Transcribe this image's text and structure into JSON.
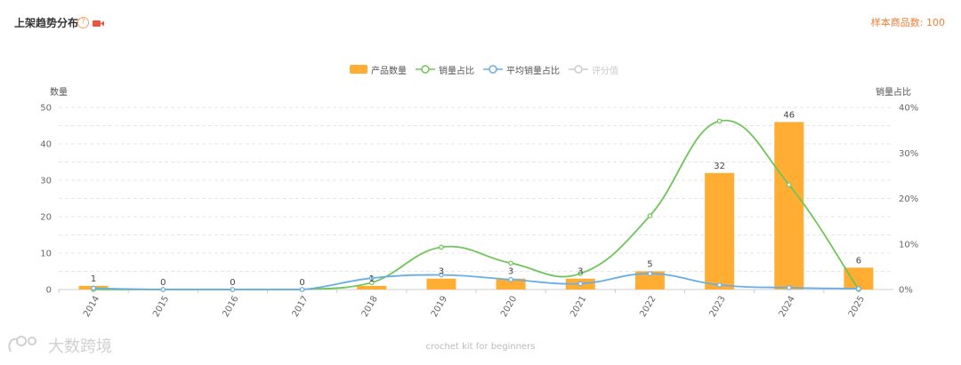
{
  "header": {
    "title": "上架趋势分布",
    "help_glyph": "?",
    "sample_count": "样本商品数: 100"
  },
  "watermark": {
    "text": "大数跨境"
  },
  "colors": {
    "bar": "#ffad33",
    "sales_share": "#70c55a",
    "avg_sales_share": "#6aaee6",
    "rating_inactive": "#cccccc",
    "axis_text": "#666666",
    "grid": "#e6e6e6"
  },
  "chart_data": {
    "type": "bar",
    "categories": [
      "2014",
      "2015",
      "2016",
      "2017",
      "2018",
      "2019",
      "2020",
      "2021",
      "2022",
      "2023",
      "2024",
      "2025"
    ],
    "series": [
      {
        "name": "产品数量",
        "type": "bar",
        "axis": "left",
        "values": [
          1,
          0,
          0,
          0,
          1,
          3,
          3,
          3,
          5,
          32,
          46,
          6
        ],
        "labels": [
          "1",
          "0",
          "0",
          "0",
          "1",
          "3",
          "3",
          "3",
          "5",
          "32",
          "46",
          "6"
        ]
      },
      {
        "name": "销量占比",
        "type": "line",
        "axis": "right",
        "values": [
          0,
          0,
          0,
          0,
          1.5,
          9.3,
          5.8,
          3.5,
          16.2,
          37.0,
          23.0,
          0
        ]
      },
      {
        "name": "平均销量占比",
        "type": "line",
        "axis": "right",
        "values": [
          0.3,
          0,
          0,
          0,
          2.5,
          3.2,
          2.2,
          1.3,
          3.5,
          1.0,
          0.4,
          0.2
        ]
      },
      {
        "name": "评分值",
        "type": "line",
        "axis": "right",
        "inactive": true,
        "values": []
      }
    ],
    "ylabel_left": "数量",
    "ylabel_right": "销量占比",
    "ylim_left": [
      0,
      50
    ],
    "ylim_right": [
      0,
      40
    ],
    "yticks_left": [
      "0",
      "10",
      "20",
      "30",
      "40",
      "50"
    ],
    "yticks_right": [
      "0%",
      "10%",
      "20%",
      "30%",
      "40%"
    ],
    "xlabel": "crochet kit for beginners",
    "legend_position": "top-center",
    "grid": true
  }
}
